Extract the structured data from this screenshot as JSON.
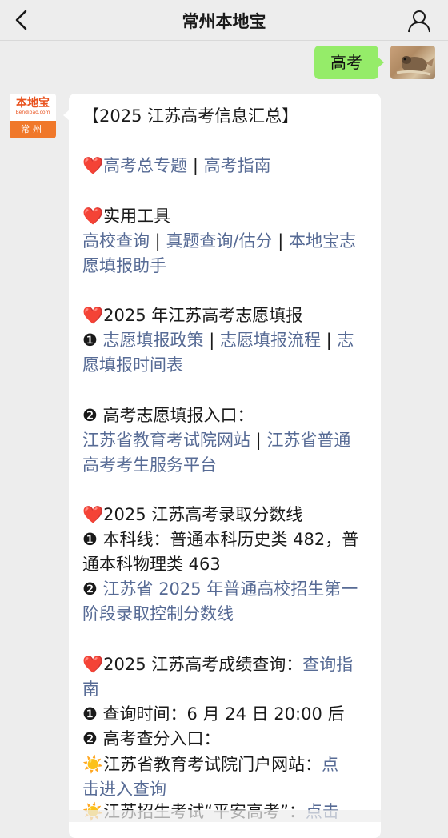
{
  "header": {
    "title": "常州本地宝"
  },
  "outgoing": {
    "text": "高考"
  },
  "sender": {
    "logo_text": "本地宝",
    "logo_sub": "Bendibao.com",
    "city": "常州"
  },
  "message": {
    "title": "【2025 江苏高考信息汇总】",
    "s1": {
      "link1": "高考总专题",
      "sep": " | ",
      "link2": "高考指南"
    },
    "s2": {
      "heading": "实用工具",
      "link1": "高校查询",
      "sep1": " | ",
      "link2": "真题查询/估分",
      "sep2": " | ",
      "link3a": "本地宝志",
      "link3b": "愿填报助手"
    },
    "s3": {
      "heading": "2025 年江苏高考志愿填报",
      "num": "❶",
      "link1": "志愿填报政策",
      "sep1": " | ",
      "link2": "志愿填报流程",
      "sep2": " | ",
      "link3a": "志",
      "link3b": "愿填报时间表"
    },
    "s4": {
      "num": "❷",
      "heading": "高考志愿填报入口：",
      "link1": "江苏省教育考试院网站",
      "sep": " | ",
      "link2a": "江苏省普通",
      "link2b": "高考考生服务平台"
    },
    "s5": {
      "heading": "2025 江苏高考录取分数线",
      "num1": "❶",
      "line1": "本科线：普通本科历史类 482，普",
      "line2": "通本科物理类 463",
      "num2": "❷",
      "link_a": "江苏省 2025 年普通高校招生第一",
      "link_b": "阶段录取控制分数线"
    },
    "s6": {
      "heading": "2025 江苏高考成绩查询：",
      "link_a": "查询指",
      "link_b": "南",
      "num1": "❶",
      "query_time": "查询时间：6 月 24 日 20:00 后",
      "num2": "❷",
      "entry": "高考查分入口：",
      "item1": "江苏省教育考试院门户网站：",
      "item1_link_a": "点",
      "item1_link_b": "击进入查询",
      "item2_partial": "江苏招生考试“平安高考”：",
      "item2_link": "点击"
    }
  },
  "icons": {
    "heart": "❤️",
    "sun": "☀️"
  }
}
